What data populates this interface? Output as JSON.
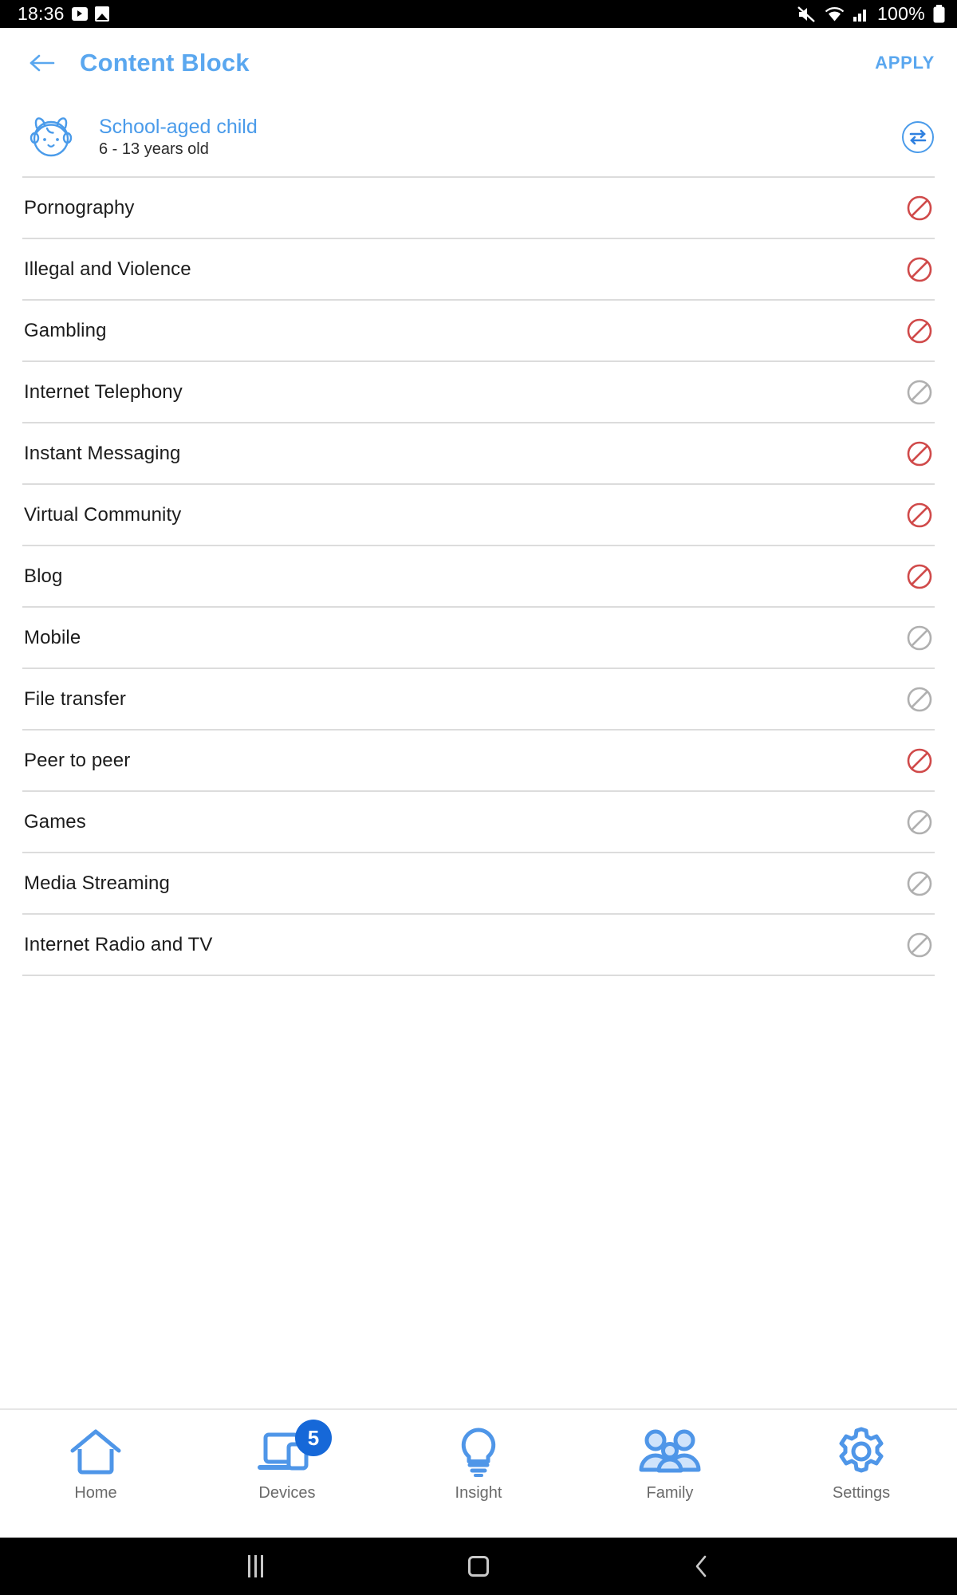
{
  "status_bar": {
    "time": "18:36",
    "icons_left": [
      "play-icon",
      "image-icon"
    ],
    "icons_right": [
      "mute-icon",
      "wifi-icon",
      "signal-icon"
    ],
    "battery_percent": "100%"
  },
  "app_bar": {
    "back_icon": "arrow-left-icon",
    "title": "Content Block",
    "apply_label": "APPLY",
    "accent_color": "#5aa7ef"
  },
  "profile": {
    "avatar_icon": "child-face-icon",
    "name": "School-aged child",
    "age_range": "6 - 13 years old",
    "switch_icon": "swap-arrows-icon"
  },
  "categories": [
    {
      "label": "Pornography",
      "blocked": true,
      "icon": "block-icon"
    },
    {
      "label": "Illegal and Violence",
      "blocked": true,
      "icon": "block-icon"
    },
    {
      "label": "Gambling",
      "blocked": true,
      "icon": "block-icon"
    },
    {
      "label": "Internet Telephony",
      "blocked": false,
      "icon": "block-icon"
    },
    {
      "label": "Instant Messaging",
      "blocked": true,
      "icon": "block-icon"
    },
    {
      "label": "Virtual Community",
      "blocked": true,
      "icon": "block-icon"
    },
    {
      "label": "Blog",
      "blocked": true,
      "icon": "block-icon"
    },
    {
      "label": "Mobile",
      "blocked": false,
      "icon": "block-icon"
    },
    {
      "label": "File transfer",
      "blocked": false,
      "icon": "block-icon"
    },
    {
      "label": "Peer to peer",
      "blocked": true,
      "icon": "block-icon"
    },
    {
      "label": "Games",
      "blocked": false,
      "icon": "block-icon"
    },
    {
      "label": "Media Streaming",
      "blocked": false,
      "icon": "block-icon"
    },
    {
      "label": "Internet Radio and TV",
      "blocked": false,
      "icon": "block-icon"
    }
  ],
  "colors": {
    "blocked": "#d04a4a",
    "unblocked": "#b0b0b0",
    "accent": "#5aa7ef",
    "badge": "#1668d8"
  },
  "bottom_nav": [
    {
      "label": "Home",
      "icon": "home-icon",
      "badge": null
    },
    {
      "label": "Devices",
      "icon": "laptop-icon",
      "badge": "5"
    },
    {
      "label": "Insight",
      "icon": "bulb-icon",
      "badge": null
    },
    {
      "label": "Family",
      "icon": "family-icon",
      "badge": null
    },
    {
      "label": "Settings",
      "icon": "gear-icon",
      "badge": null
    }
  ],
  "android_nav": {
    "recents_icon": "recents-icon",
    "home_icon": "home-circle-icon",
    "back_icon": "back-chevron-icon"
  }
}
